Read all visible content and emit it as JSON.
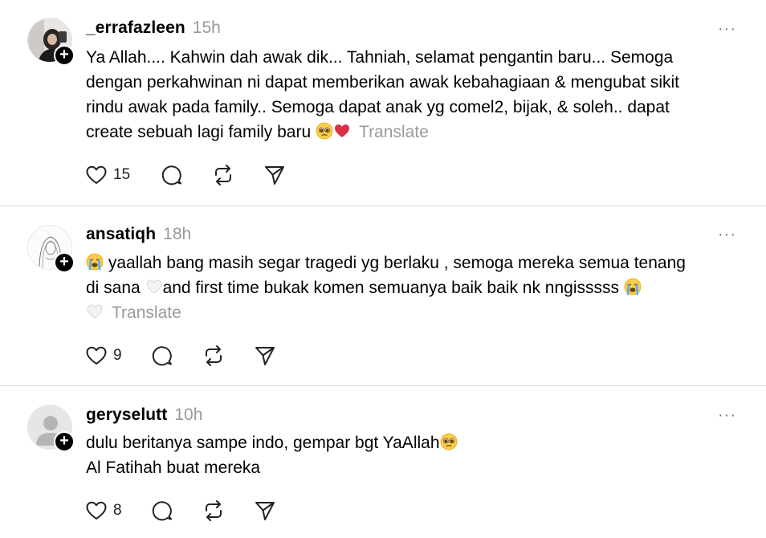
{
  "posts": [
    {
      "username": "_errafazleen",
      "time": "15h",
      "more": "···",
      "lines": [
        "Ya Allah.... Kahwin dah awak dik... Tahniah, selamat pengantin baru... Semoga",
        "dengan perkahwinan ni dapat memberikan awak kebahagiaan & mengubat sikit",
        "rindu awak pada family.. Semoga dapat anak yg comel2, bijak, & soleh.. dapat",
        "create sebuah lagi family baru"
      ],
      "translate": "Translate",
      "likes": "15",
      "emojis": [
        "pleading-face-icon",
        "red-heart-icon"
      ]
    },
    {
      "username": "ansatiqh",
      "time": "18h",
      "more": "···",
      "lines": [
        "yaallah bang masih segar tragedi yg berlaku , semoga mereka semua tenang",
        "di sana",
        "and first time bukak komen semuanya baik baik nk nngisssss"
      ],
      "translate": "Translate",
      "likes": "9",
      "emojis": [
        "loudly-crying-face-icon",
        "white-heart-icon"
      ]
    },
    {
      "username": "geryselutt",
      "time": "10h",
      "more": "···",
      "lines": [
        "dulu beritanya sampe indo, gempar bgt YaAllah",
        "Al Fatihah buat mereka"
      ],
      "likes": "8",
      "emojis": [
        "pleading-face-icon"
      ]
    }
  ],
  "colors": {
    "text": "#000000",
    "muted": "#999999",
    "divider": "#d9d9d9",
    "follow_badge": "#000000"
  }
}
